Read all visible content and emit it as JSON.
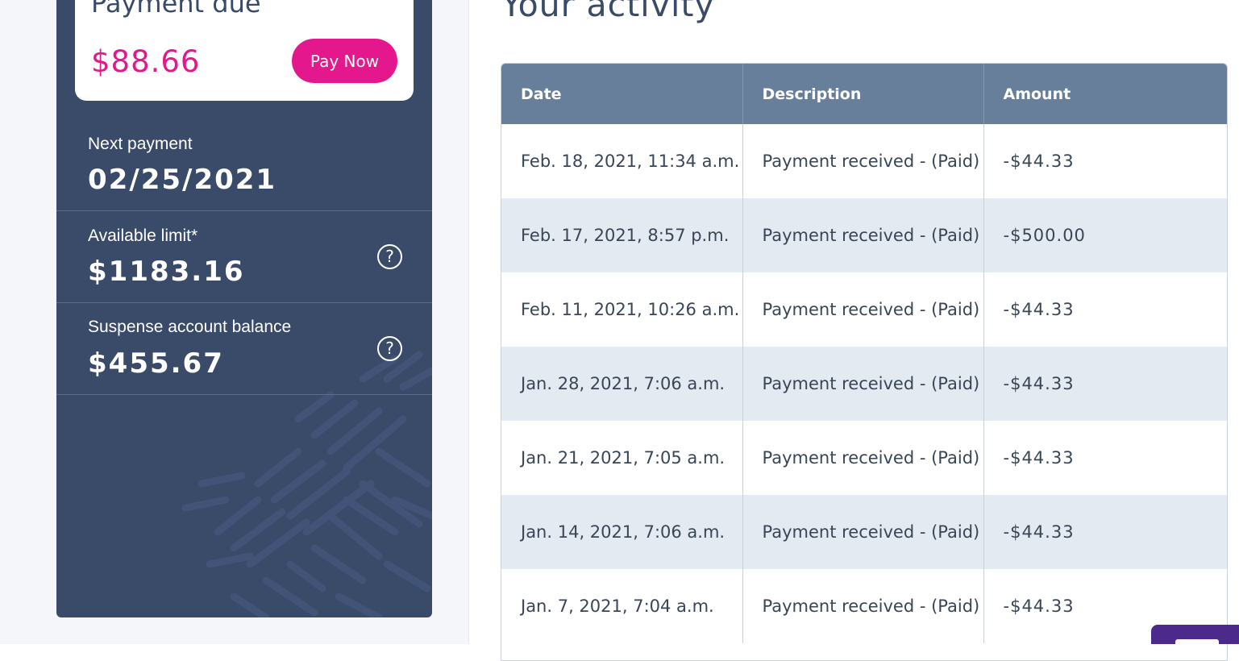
{
  "payment_due": {
    "title": "Payment due",
    "amount": "$88.66",
    "pay_button": "Pay Now"
  },
  "next_payment": {
    "label": "Next payment",
    "value": "02/25/2021"
  },
  "available_limit": {
    "label": "Available limit*",
    "value": "$1183.16",
    "help": "?"
  },
  "suspense_balance": {
    "label": "Suspense account balance",
    "value": "$455.67",
    "help": "?"
  },
  "activity": {
    "title": "Your activity",
    "columns": [
      "Date",
      "Description",
      "Amount"
    ],
    "rows": [
      {
        "date": "Feb. 18, 2021, 11:34 a.m.",
        "description": "Payment received - (Paid)",
        "amount": "-$44.33"
      },
      {
        "date": "Feb. 17, 2021, 8:57 p.m.",
        "description": "Payment received - (Paid)",
        "amount": "-$500.00"
      },
      {
        "date": "Feb. 11, 2021, 10:26 a.m.",
        "description": "Payment received - (Paid)",
        "amount": "-$44.33"
      },
      {
        "date": "Jan. 28, 2021, 7:06 a.m.",
        "description": "Payment received - (Paid)",
        "amount": "-$44.33"
      },
      {
        "date": "Jan. 21, 2021, 7:05 a.m.",
        "description": "Payment received - (Paid)",
        "amount": "-$44.33"
      },
      {
        "date": "Jan. 14, 2021, 7:06 a.m.",
        "description": "Payment received - (Paid)",
        "amount": "-$44.33"
      },
      {
        "date": "Jan. 7, 2021, 7:04 a.m.",
        "description": "Payment received - (Paid)",
        "amount": "-$44.33"
      }
    ]
  },
  "colors": {
    "panel_bg": "#3a4a69",
    "accent_pink": "#e5178c",
    "table_header": "#677f9b",
    "row_alt": "#e4eaf2",
    "chat_widget": "#4b2a8c"
  }
}
